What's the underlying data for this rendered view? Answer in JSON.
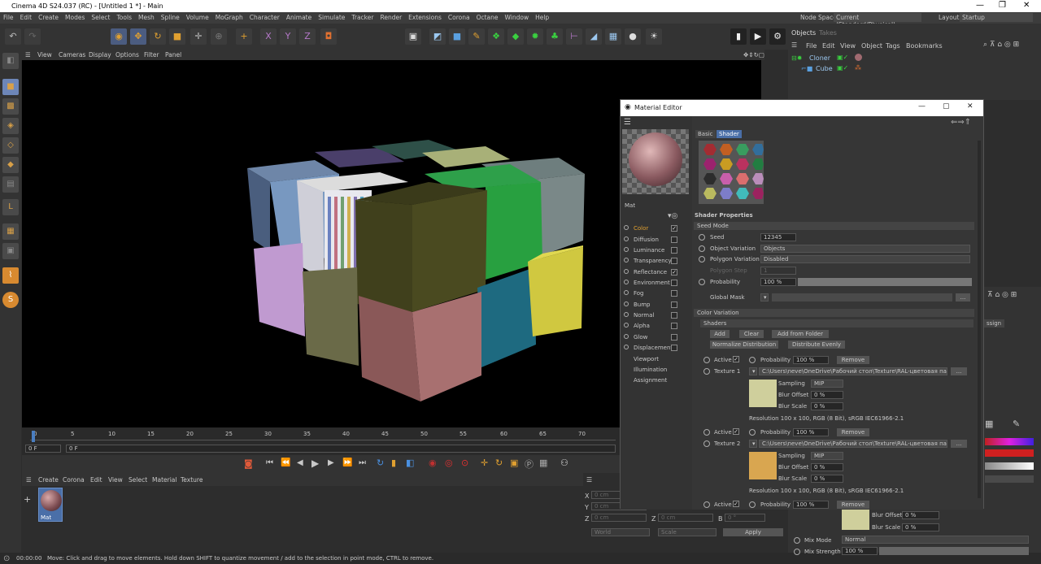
{
  "window": {
    "title": "Cinema 4D S24.037 (RC) - [Untitled 1 *] - Main"
  },
  "menu": [
    "File",
    "Edit",
    "Create",
    "Modes",
    "Select",
    "Tools",
    "Mesh",
    "Spline",
    "Volume",
    "MoGraph",
    "Character",
    "Animate",
    "Simulate",
    "Tracker",
    "Render",
    "Extensions",
    "Corona",
    "Octane",
    "Window",
    "Help"
  ],
  "nodespace": {
    "label": "Node Space:",
    "value": "Current (Standard/Physical)"
  },
  "layout": {
    "label": "Layout:",
    "value": "Startup"
  },
  "viewport_menu": [
    "View",
    "Cameras",
    "Display",
    "Options",
    "Filter",
    "Panel"
  ],
  "timeline": {
    "ticks": [
      "0",
      "5",
      "10",
      "15",
      "20",
      "25",
      "30",
      "35",
      "40",
      "45",
      "50",
      "55",
      "60",
      "65",
      "70"
    ],
    "start": "0 F",
    "current": "0 F"
  },
  "material_menu": [
    "Create",
    "Corona",
    "Edit",
    "View",
    "Select",
    "Material",
    "Texture"
  ],
  "material": {
    "name": "Mat"
  },
  "coords": {
    "x": "0 cm",
    "y": "0 cm",
    "z": "0 cm",
    "z2": "0 cm",
    "b": "0 °",
    "world": "World",
    "scale": "Scale",
    "apply": "Apply"
  },
  "status": {
    "time": "00:00:00",
    "text": "Move: Click and drag to move elements. Hold down SHIFT to quantize movement / add to the selection in point mode, CTRL to remove."
  },
  "objects": {
    "tabs": [
      "Objects",
      "Takes"
    ],
    "menu": [
      "File",
      "Edit",
      "View",
      "Object",
      "Tags",
      "Bookmarks"
    ],
    "items": [
      "Cloner",
      "Cube"
    ]
  },
  "material_editor": {
    "title": "Material Editor",
    "mat_name": "Mat",
    "channels": [
      {
        "name": "Color",
        "checked": "✓"
      },
      {
        "name": "Diffusion",
        "checked": ""
      },
      {
        "name": "Luminance",
        "checked": ""
      },
      {
        "name": "Transparency",
        "checked": ""
      },
      {
        "name": "Reflectance",
        "checked": "✓"
      },
      {
        "name": "Environment",
        "checked": ""
      },
      {
        "name": "Fog",
        "checked": ""
      },
      {
        "name": "Bump",
        "checked": ""
      },
      {
        "name": "Normal",
        "checked": ""
      },
      {
        "name": "Alpha",
        "checked": ""
      },
      {
        "name": "Glow",
        "checked": ""
      },
      {
        "name": "Displacement",
        "checked": ""
      }
    ],
    "extra": [
      "Viewport",
      "Illumination",
      "Assignment"
    ],
    "tabs": [
      "Basic",
      "Shader"
    ],
    "shader_props": "Shader Properties",
    "seed_mode": "Seed Mode",
    "seed": {
      "label": "Seed",
      "value": "12345"
    },
    "object_variation": {
      "label": "Object Variation",
      "value": "Objects"
    },
    "polygon_variation": {
      "label": "Polygon Variation",
      "value": "Disabled"
    },
    "polygon_step": {
      "label": "Polygon Step",
      "value": "1"
    },
    "probability": {
      "label": "Probability",
      "value": "100 %"
    },
    "global_mask": {
      "label": "Global Mask"
    },
    "color_variation": "Color Variation",
    "shaders": "Shaders",
    "buttons": [
      "Add",
      "Clear",
      "Add from Folder",
      "Normalize Distribution",
      "Distribute Evenly"
    ],
    "active_label": "Active",
    "prob_label": "Probability",
    "prob_value": "100 %",
    "remove": "Remove",
    "textures": [
      {
        "label": "Texture 1",
        "path": "C:\\Users\\neve\\OneDrive\\Рабочий стол\\Texture\\RAL-цветовая палит",
        "sampling": "MIP",
        "blur_offset": "0 %",
        "blur_scale": "0 %",
        "swatch": "#cfcf9c",
        "resolution": "Resolution 100 x 100, RGB (8 Bit), sRGB IEC61966-2.1"
      },
      {
        "label": "Texture 2",
        "path": "C:\\Users\\neve\\OneDrive\\Рабочий стол\\Texture\\RAL-цветовая палит",
        "sampling": "MIP",
        "blur_offset": "0 %",
        "blur_scale": "0 %",
        "swatch": "#d9a650",
        "resolution": "Resolution 100 x 100, RGB (8 Bit), sRGB IEC61966-2.1"
      }
    ],
    "sampling_label": "Sampling",
    "blur_offset_label": "Blur Offset",
    "blur_scale_label": "Blur Scale"
  },
  "attr": {
    "assign": "ssign",
    "blur_offset": {
      "label": "Blur Offset",
      "value": "0 %"
    },
    "blur_scale": {
      "label": "Blur Scale",
      "value": "0 %"
    },
    "mix_mode": {
      "label": "Mix Mode",
      "value": "Normal"
    },
    "mix_strength": {
      "label": "Mix Strength",
      "value": "100 %"
    }
  }
}
